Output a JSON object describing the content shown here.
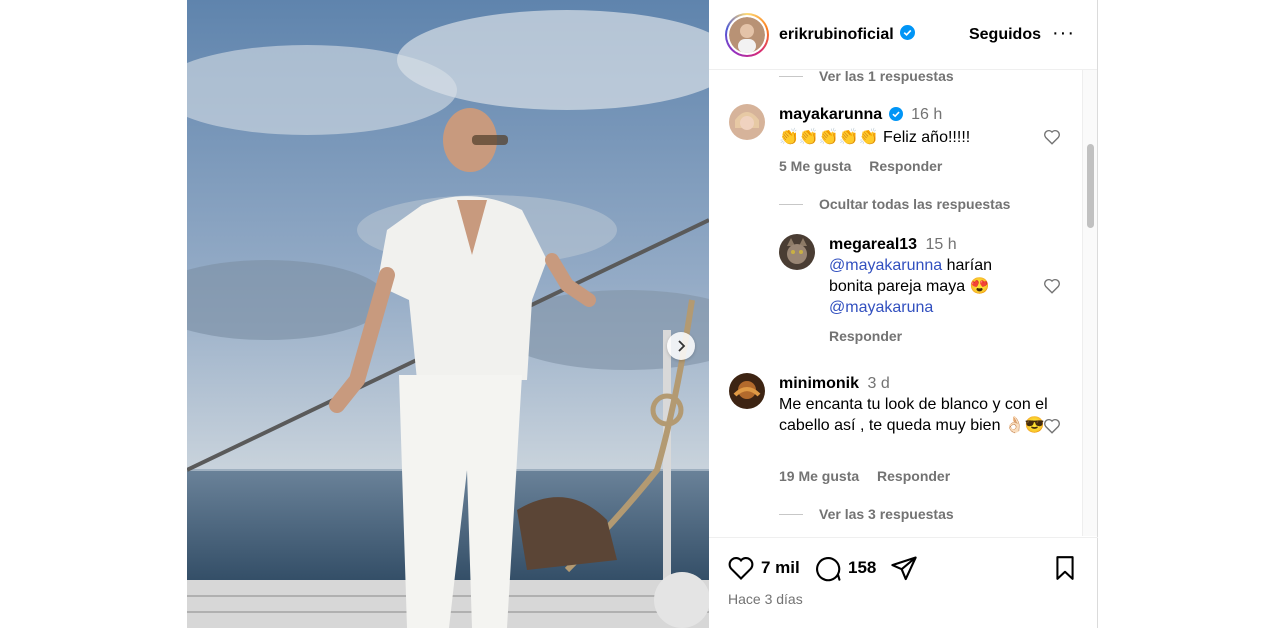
{
  "post": {
    "username": "erikrubinoficial",
    "follow_label": "Seguidos",
    "more_label": "···"
  },
  "comments": {
    "view_replies_top": "Ver las 1 respuestas",
    "items": [
      {
        "author": "mayakarunna",
        "verified": true,
        "time": "16 h",
        "text": "👏👏👏👏👏 Feliz año!!!!!",
        "likes": "5 Me gusta",
        "reply": "Responder"
      },
      {
        "author": "megareal13",
        "time": "15 h",
        "mention1": "@mayakarunna",
        "text_mid": " harían bonita pareja maya 😍",
        "mention2": "@mayakaruna",
        "reply": "Responder"
      },
      {
        "author": "minimonik",
        "time": "3 d",
        "text": "Me encanta tu look de blanco y con el cabello así , te queda muy bien 👌🏻😎",
        "likes": "19 Me gusta",
        "reply": "Responder"
      }
    ],
    "hide_replies": "Ocultar todas las respuestas",
    "view_replies_bottom": "Ver las 3 respuestas"
  },
  "actions": {
    "likes": "7 mil",
    "comments": "158",
    "posted": "Hace 3 días"
  },
  "colors": {
    "accent": "#0095f6",
    "mention": "#3250bf",
    "muted": "#737373"
  }
}
